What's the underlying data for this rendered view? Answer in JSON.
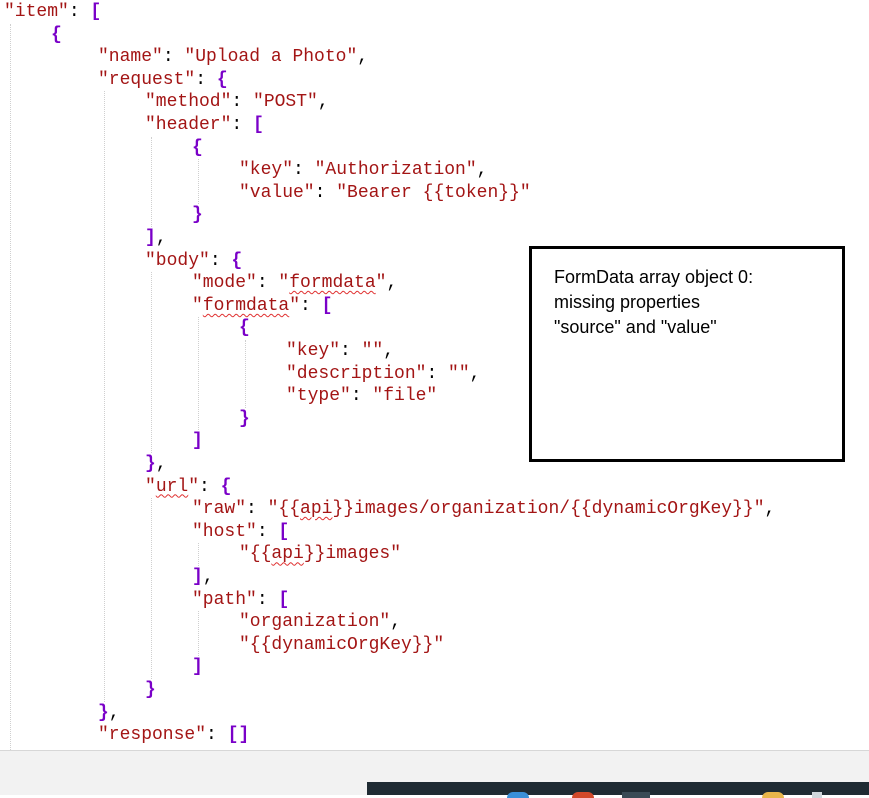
{
  "code_lines": [
    {
      "indent": 0,
      "tokens": [
        {
          "t": "\"item\"",
          "k": "key"
        },
        {
          "t": ": ",
          "k": "plain"
        },
        {
          "t": "[",
          "k": "punc"
        }
      ]
    },
    {
      "indent": 1,
      "tokens": [
        {
          "t": "{",
          "k": "punc"
        }
      ]
    },
    {
      "indent": 2,
      "tokens": [
        {
          "t": "\"name\"",
          "k": "key"
        },
        {
          "t": ": ",
          "k": "plain"
        },
        {
          "t": "\"Upload a Photo\"",
          "k": "str"
        },
        {
          "t": ",",
          "k": "plain"
        }
      ]
    },
    {
      "indent": 2,
      "tokens": [
        {
          "t": "\"request\"",
          "k": "key"
        },
        {
          "t": ": ",
          "k": "plain"
        },
        {
          "t": "{",
          "k": "punc"
        }
      ]
    },
    {
      "indent": 3,
      "tokens": [
        {
          "t": "\"method\"",
          "k": "key"
        },
        {
          "t": ": ",
          "k": "plain"
        },
        {
          "t": "\"POST\"",
          "k": "str"
        },
        {
          "t": ",",
          "k": "plain"
        }
      ]
    },
    {
      "indent": 3,
      "tokens": [
        {
          "t": "\"header\"",
          "k": "key"
        },
        {
          "t": ": ",
          "k": "plain"
        },
        {
          "t": "[",
          "k": "punc"
        }
      ]
    },
    {
      "indent": 4,
      "tokens": [
        {
          "t": "{",
          "k": "punc"
        }
      ]
    },
    {
      "indent": 5,
      "tokens": [
        {
          "t": "\"key\"",
          "k": "key"
        },
        {
          "t": ": ",
          "k": "plain"
        },
        {
          "t": "\"Authorization\"",
          "k": "str"
        },
        {
          "t": ",",
          "k": "plain"
        }
      ]
    },
    {
      "indent": 5,
      "tokens": [
        {
          "t": "\"value\"",
          "k": "key"
        },
        {
          "t": ": ",
          "k": "plain"
        },
        {
          "t": "\"Bearer {{token}}\"",
          "k": "str"
        }
      ]
    },
    {
      "indent": 4,
      "tokens": [
        {
          "t": "}",
          "k": "punc"
        }
      ]
    },
    {
      "indent": 3,
      "tokens": [
        {
          "t": "]",
          "k": "punc"
        },
        {
          "t": ",",
          "k": "plain"
        }
      ]
    },
    {
      "indent": 3,
      "tokens": [
        {
          "t": "\"body\"",
          "k": "key"
        },
        {
          "t": ": ",
          "k": "plain"
        },
        {
          "t": "{",
          "k": "punc"
        }
      ]
    },
    {
      "indent": 4,
      "tokens": [
        {
          "t": "\"mode\"",
          "k": "key"
        },
        {
          "t": ": ",
          "k": "plain"
        },
        {
          "t": "\"",
          "k": "str"
        },
        {
          "t": "formdata",
          "k": "str",
          "squiggle": true
        },
        {
          "t": "\"",
          "k": "str"
        },
        {
          "t": ",",
          "k": "plain"
        }
      ]
    },
    {
      "indent": 4,
      "tokens": [
        {
          "t": "\"",
          "k": "key"
        },
        {
          "t": "formdata",
          "k": "key",
          "squiggle": true
        },
        {
          "t": "\"",
          "k": "key"
        },
        {
          "t": ": ",
          "k": "plain"
        },
        {
          "t": "[",
          "k": "punc"
        }
      ]
    },
    {
      "indent": 5,
      "tokens": [
        {
          "t": "{",
          "k": "punc"
        }
      ]
    },
    {
      "indent": 6,
      "tokens": [
        {
          "t": "\"key\"",
          "k": "key"
        },
        {
          "t": ": ",
          "k": "plain"
        },
        {
          "t": "\"\"",
          "k": "str"
        },
        {
          "t": ",",
          "k": "plain"
        }
      ]
    },
    {
      "indent": 6,
      "tokens": [
        {
          "t": "\"description\"",
          "k": "key"
        },
        {
          "t": ": ",
          "k": "plain"
        },
        {
          "t": "\"\"",
          "k": "str"
        },
        {
          "t": ",",
          "k": "plain"
        }
      ]
    },
    {
      "indent": 6,
      "tokens": [
        {
          "t": "\"type\"",
          "k": "key"
        },
        {
          "t": ": ",
          "k": "plain"
        },
        {
          "t": "\"file\"",
          "k": "str"
        }
      ]
    },
    {
      "indent": 5,
      "tokens": [
        {
          "t": "}",
          "k": "punc"
        }
      ]
    },
    {
      "indent": 4,
      "tokens": [
        {
          "t": "]",
          "k": "punc"
        }
      ]
    },
    {
      "indent": 3,
      "tokens": [
        {
          "t": "}",
          "k": "punc"
        },
        {
          "t": ",",
          "k": "plain"
        }
      ]
    },
    {
      "indent": 3,
      "tokens": [
        {
          "t": "\"",
          "k": "key"
        },
        {
          "t": "url",
          "k": "key",
          "squiggle": true
        },
        {
          "t": "\"",
          "k": "key"
        },
        {
          "t": ": ",
          "k": "plain"
        },
        {
          "t": "{",
          "k": "punc"
        }
      ]
    },
    {
      "indent": 4,
      "tokens": [
        {
          "t": "\"raw\"",
          "k": "key"
        },
        {
          "t": ": ",
          "k": "plain"
        },
        {
          "t": "\"{{",
          "k": "str"
        },
        {
          "t": "api",
          "k": "str",
          "squiggle": true
        },
        {
          "t": "}}images/organization/{{dynamicOrgKey}}\"",
          "k": "str"
        },
        {
          "t": ",",
          "k": "plain"
        }
      ]
    },
    {
      "indent": 4,
      "tokens": [
        {
          "t": "\"host\"",
          "k": "key"
        },
        {
          "t": ": ",
          "k": "plain"
        },
        {
          "t": "[",
          "k": "punc"
        }
      ]
    },
    {
      "indent": 5,
      "tokens": [
        {
          "t": "\"{{",
          "k": "str"
        },
        {
          "t": "api",
          "k": "str",
          "squiggle": true
        },
        {
          "t": "}}images\"",
          "k": "str"
        }
      ]
    },
    {
      "indent": 4,
      "tokens": [
        {
          "t": "]",
          "k": "punc"
        },
        {
          "t": ",",
          "k": "plain"
        }
      ]
    },
    {
      "indent": 4,
      "tokens": [
        {
          "t": "\"path\"",
          "k": "key"
        },
        {
          "t": ": ",
          "k": "plain"
        },
        {
          "t": "[",
          "k": "punc"
        }
      ]
    },
    {
      "indent": 5,
      "tokens": [
        {
          "t": "\"organization\"",
          "k": "str"
        },
        {
          "t": ",",
          "k": "plain"
        }
      ]
    },
    {
      "indent": 5,
      "tokens": [
        {
          "t": "\"{{dynamicOrgKey}}\"",
          "k": "str"
        }
      ]
    },
    {
      "indent": 4,
      "tokens": [
        {
          "t": "]",
          "k": "punc"
        }
      ]
    },
    {
      "indent": 3,
      "tokens": [
        {
          "t": "}",
          "k": "punc"
        }
      ]
    },
    {
      "indent": 2,
      "tokens": [
        {
          "t": "}",
          "k": "punc"
        },
        {
          "t": ",",
          "k": "plain"
        }
      ]
    },
    {
      "indent": 2,
      "tokens": [
        {
          "t": "\"response\"",
          "k": "key"
        },
        {
          "t": ": ",
          "k": "plain"
        },
        {
          "t": "[]",
          "k": "punc"
        }
      ]
    }
  ],
  "annotation": {
    "lines": [
      "FormData array object 0:",
      "missing properties",
      "\"source\" and \"value\""
    ]
  },
  "colors": {
    "key": "#a31515",
    "string": "#a31515",
    "punctuation": "#7a00c8",
    "squiggle": "#e03030",
    "taskbar": "#1f2b33"
  }
}
